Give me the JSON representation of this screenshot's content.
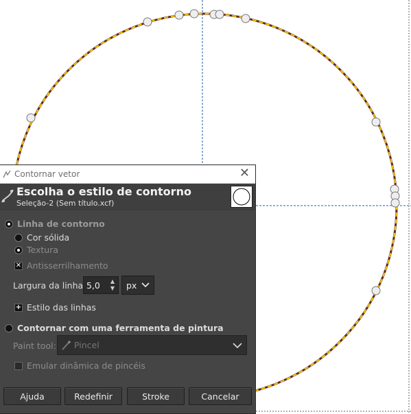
{
  "dialog": {
    "window_title": "Contornar vetor",
    "heading": "Escolha o estilo de contorno",
    "subheading": "Seleção-2 (Sem título.xcf)",
    "options": {
      "stroke_line": "Linha de contorno",
      "solid_color": "Cor sólida",
      "texture": "Textura",
      "antialiasing": "Antisserrilhamento",
      "line_width_label": "Largura da linha:",
      "line_width_value": "5,0",
      "line_width_unit": "px",
      "line_style": "Estilo das linhas",
      "paint_tool_mode": "Contornar com uma ferramenta de pintura",
      "paint_tool_label": "Paint tool:",
      "paint_tool_value": "Pincel",
      "emulate_dynamics": "Emular dinâmica de pincéis"
    },
    "buttons": {
      "help": "Ajuda",
      "reset": "Redefinir",
      "stroke": "Stroke",
      "cancel": "Cancelar"
    }
  },
  "colors": {
    "path_yellow": "#f5c400",
    "path_dark": "#6b2f1f",
    "guide_blue": "#1e5fa8",
    "dialog_bg": "#454545"
  }
}
